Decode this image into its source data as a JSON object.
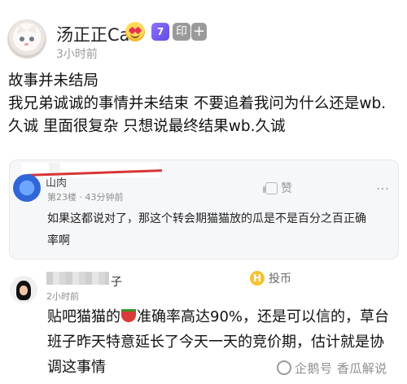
{
  "post": {
    "username": "汤正正Cat",
    "level_badge": "7",
    "tag_badge": "印",
    "plus_badge": "+",
    "time": "3小时前",
    "lines": [
      "故事并未结局",
      "我兄弟诚诚的事情并未结束 不要追着我问为什么还是wb.久诚 里面很复杂 只想说最终结果wb.久诚"
    ]
  },
  "reply1": {
    "name_fragment": "山肉",
    "meta": "第23楼 · 43分钟前",
    "like_label": "赞",
    "more": "···",
    "text": "如果这都说对了，那这个转会期猫猫放的瓜是不是百分之百正确率啊"
  },
  "reply2": {
    "name_fragment": "子",
    "time": "2小时前",
    "coin_label": "投币",
    "coin_icon": "H",
    "text_before_icon": "贴吧猫猫的",
    "text_after_icon": "准确率高达90%，还是可以信的，草台班子昨天特意延长了今天一天的竞价期，估计就是协调这事情"
  },
  "watermark": {
    "text": "企鹅号 香瓜解说"
  },
  "colors": {
    "accent_purple": "#7b61ff",
    "muted_text": "#9a9a9a",
    "card_bg": "#f6f7f9",
    "redaction_red": "#d83535",
    "coin_yellow": "#f4c232"
  }
}
